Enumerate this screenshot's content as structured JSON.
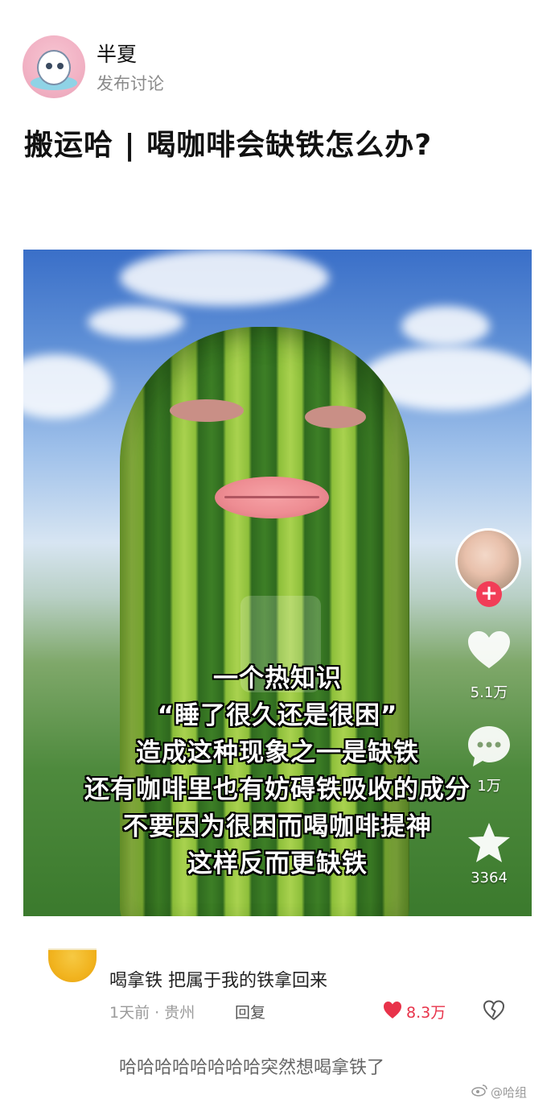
{
  "header": {
    "author_name": "半夏",
    "author_subtitle": "发布讨论"
  },
  "post": {
    "title": "搬运哈 | 喝咖啡会缺铁怎么办?"
  },
  "video": {
    "caption_lines": [
      "一个热知识",
      "“睡了很久还是很困”",
      "造成这种现象之一是缺铁",
      "还有咖啡里也有妨碍铁吸收的成分",
      "不要因为很困而喝咖啡提神",
      "这样反而更缺铁"
    ],
    "follow_symbol": "+",
    "like_count": "5.1万",
    "comment_count": "1万",
    "favorite_count": "3364"
  },
  "comment": {
    "text": "喝拿铁 把属于我的铁拿回来",
    "meta": "1天前 · 贵州",
    "reply_label": "回复",
    "like_count": "8.3万"
  },
  "reply_preview": {
    "text": "哈哈哈哈哈哈哈哈突然想喝拿铁了"
  },
  "watermark": {
    "text": "@哈组"
  },
  "colors": {
    "accent_red": "#e8334a",
    "follow_red": "#f23d57"
  },
  "icons": [
    "heart-icon",
    "comment-bubble-icon",
    "star-icon",
    "heart-filled-icon",
    "heart-broken-icon",
    "weibo-icon"
  ]
}
